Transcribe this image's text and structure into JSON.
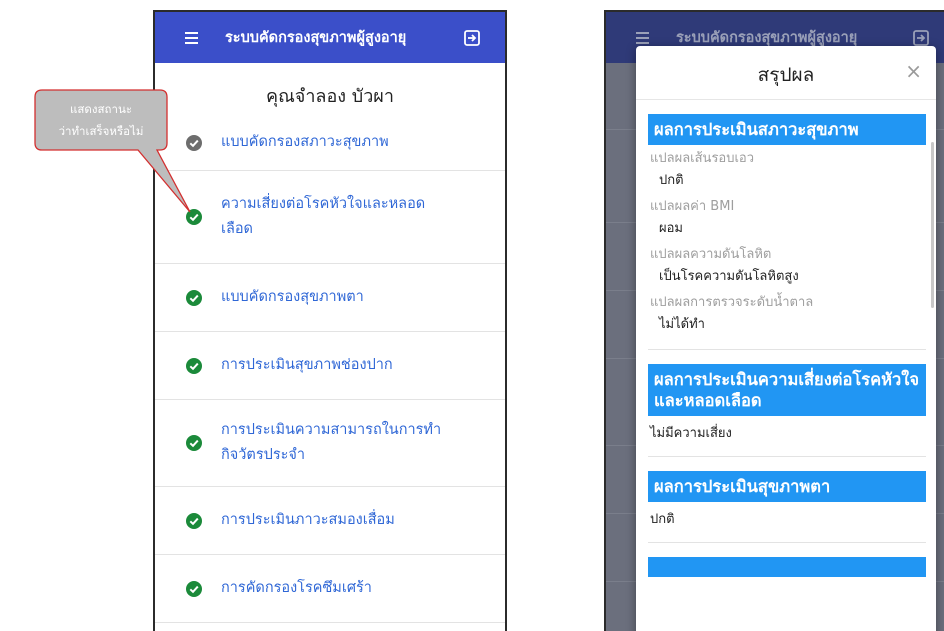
{
  "left_screen": {
    "app_title": "ระบบคัดกรองสุขภาพผู้สูงอายุ",
    "patient_name": "คุณจำลอง บัวผา",
    "forms": [
      {
        "label": "แบบคัดกรองสภาวะสุขภาพ",
        "status": "done-gray"
      },
      {
        "label": "ความเสี่ยงต่อโรคหัวใจและหลอด\nเลือด",
        "status": "done-green"
      },
      {
        "label": "แบบคัดกรองสุขภาพตา",
        "status": "done-green"
      },
      {
        "label": "การประเมินสุขภาพช่องปาก",
        "status": "done-green"
      },
      {
        "label": "การประเมินความสามารถในการทำ\nกิจวัตรประจำ",
        "status": "done-green"
      },
      {
        "label": "การประเมินภาวะสมองเสื่อม",
        "status": "done-green"
      },
      {
        "label": "การคัดกรองโรคซึมเศร้า",
        "status": "done-green"
      }
    ]
  },
  "callout": {
    "line1": "แสดงสถานะ",
    "line2": "ว่าทำเสร็จหรือไม่"
  },
  "right_screen": {
    "app_title": "ระบบคัดกรองสุขภาพผู้สูงอายุ",
    "modal": {
      "title": "สรุปผล",
      "close_label": "×",
      "health_section": {
        "heading": "ผลการประเมินสภาวะสุขภาพ",
        "fields": [
          {
            "label": "แปลผลเส้นรอบเอว",
            "value": "ปกติ"
          },
          {
            "label": "แปลผลค่า BMI",
            "value": "ผอม"
          },
          {
            "label": "แปลผลความดันโลหิต",
            "value": "เป็นโรคความดันโลหิตสูง"
          },
          {
            "label": "แปลผลการตรวจระดับน้ำตาล",
            "value": "ไม่ได้ทำ"
          }
        ]
      },
      "heart_section": {
        "heading": "ผลการประเมินความเสี่ยงต่อโรคหัวใจและหลอดเลือด",
        "value": "ไม่มีความเสี่ยง"
      },
      "eye_section": {
        "heading": "ผลการประเมินสุขภาพตา",
        "value": "ปกติ"
      }
    }
  },
  "colors": {
    "appbar": "#3b4fc9",
    "appbar_dimmed": "#2f3a78",
    "link_blue": "#2f67d6",
    "check_green": "#1b8a3a",
    "check_gray": "#6d6d6d",
    "section_blue": "#2196f3",
    "callout_gray": "#bdbdbd",
    "callout_border": "#d32f2f"
  }
}
